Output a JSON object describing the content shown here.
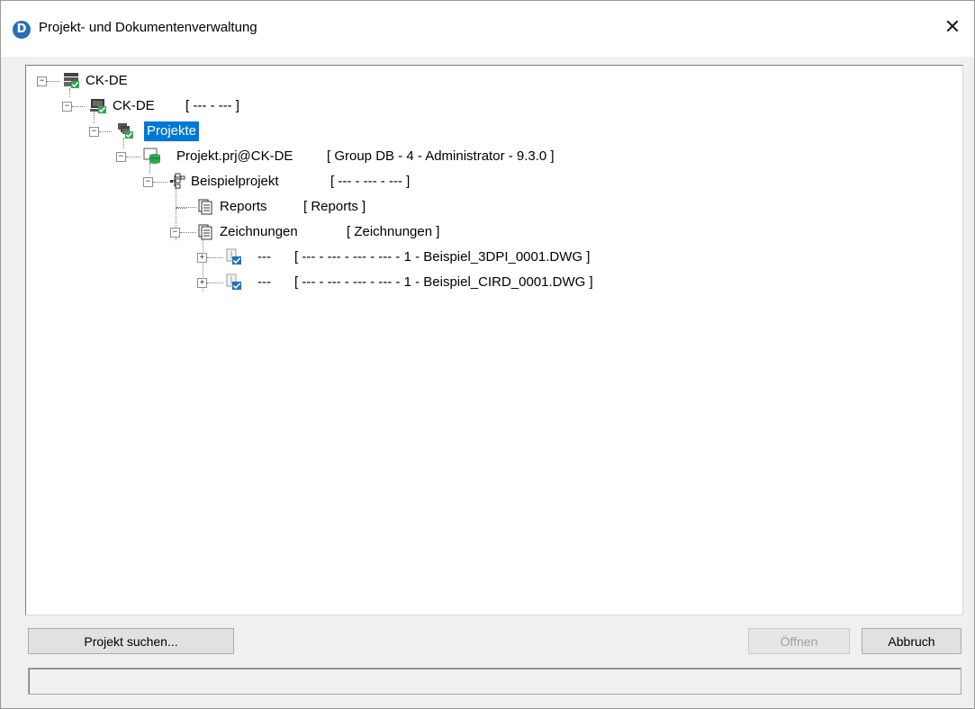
{
  "window": {
    "title": "Projekt- und Dokumentenverwaltung",
    "close_glyph": "✕",
    "app_icon_letter": "D"
  },
  "tree": {
    "nodes": [
      {
        "label": "CK-DE",
        "extra": "",
        "icon": "server-stack-icon"
      },
      {
        "label": "CK-DE",
        "extra": "[ --- - --- ]",
        "icon": "computer-icon"
      },
      {
        "label": "Projekte",
        "extra": "",
        "icon": "projects-folder-icon",
        "selected": true
      },
      {
        "label": "Projekt.prj@CK-DE",
        "extra": "[ Group DB - 4 - Administrator - 9.3.0 ]",
        "icon": "database-icon"
      },
      {
        "label": "Beispielprojekt",
        "extra": "[ --- - --- - --- ]",
        "icon": "project-structure-icon"
      },
      {
        "label": "Reports",
        "extra": "[ Reports ]",
        "icon": "documents-icon"
      },
      {
        "label": "Zeichnungen",
        "extra": "[ Zeichnungen ]",
        "icon": "documents-icon"
      },
      {
        "label": "---",
        "extra": "[ --- - --- - --- - --- - 1 - Beispiel_3DPI_0001.DWG ]",
        "icon": "drawing-checked-icon"
      },
      {
        "label": "---",
        "extra": "[ --- - --- - --- - --- - 1 - Beispiel_CIRD_0001.DWG ]",
        "icon": "drawing-checked-icon"
      }
    ]
  },
  "buttons": {
    "search_label": "Projekt suchen...",
    "open_label": "Öffnen",
    "cancel_label": "Abbruch"
  },
  "expander": {
    "collapse": "−",
    "expand": "+"
  },
  "colors": {
    "selection": "#0078d7",
    "check_green": "#2fa84f",
    "check_blue": "#1f6fc4"
  }
}
